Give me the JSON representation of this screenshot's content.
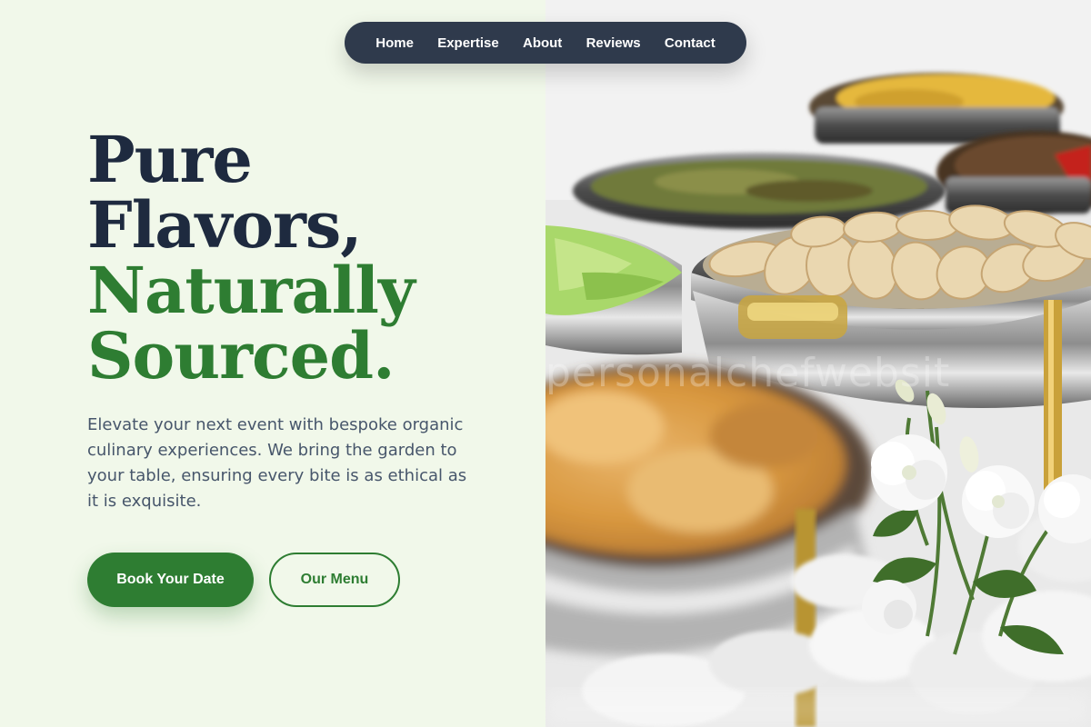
{
  "nav": {
    "links": [
      {
        "label": "Home"
      },
      {
        "label": "Expertise"
      },
      {
        "label": "About"
      },
      {
        "label": "Reviews"
      },
      {
        "label": "Contact"
      }
    ]
  },
  "hero": {
    "headline": {
      "line1": "Pure",
      "line2": "Flavors,",
      "line3": "Naturally",
      "line4": "Sourced."
    },
    "description": "Elevate your next event with bespoke organic culinary experiences. We bring the garden to your table, ensuring every bite is as ethical as it is exquisite.",
    "primary_cta": "Book Your Date",
    "secondary_cta": "Our Menu"
  },
  "photo": {
    "watermark": "personalchefwebsit"
  },
  "colors": {
    "background": "#f1f8ea",
    "heading_dark": "#1e2a3f",
    "accent_green": "#2e7d32",
    "nav_background": "#2f3a4c",
    "body_text": "#47566b"
  }
}
